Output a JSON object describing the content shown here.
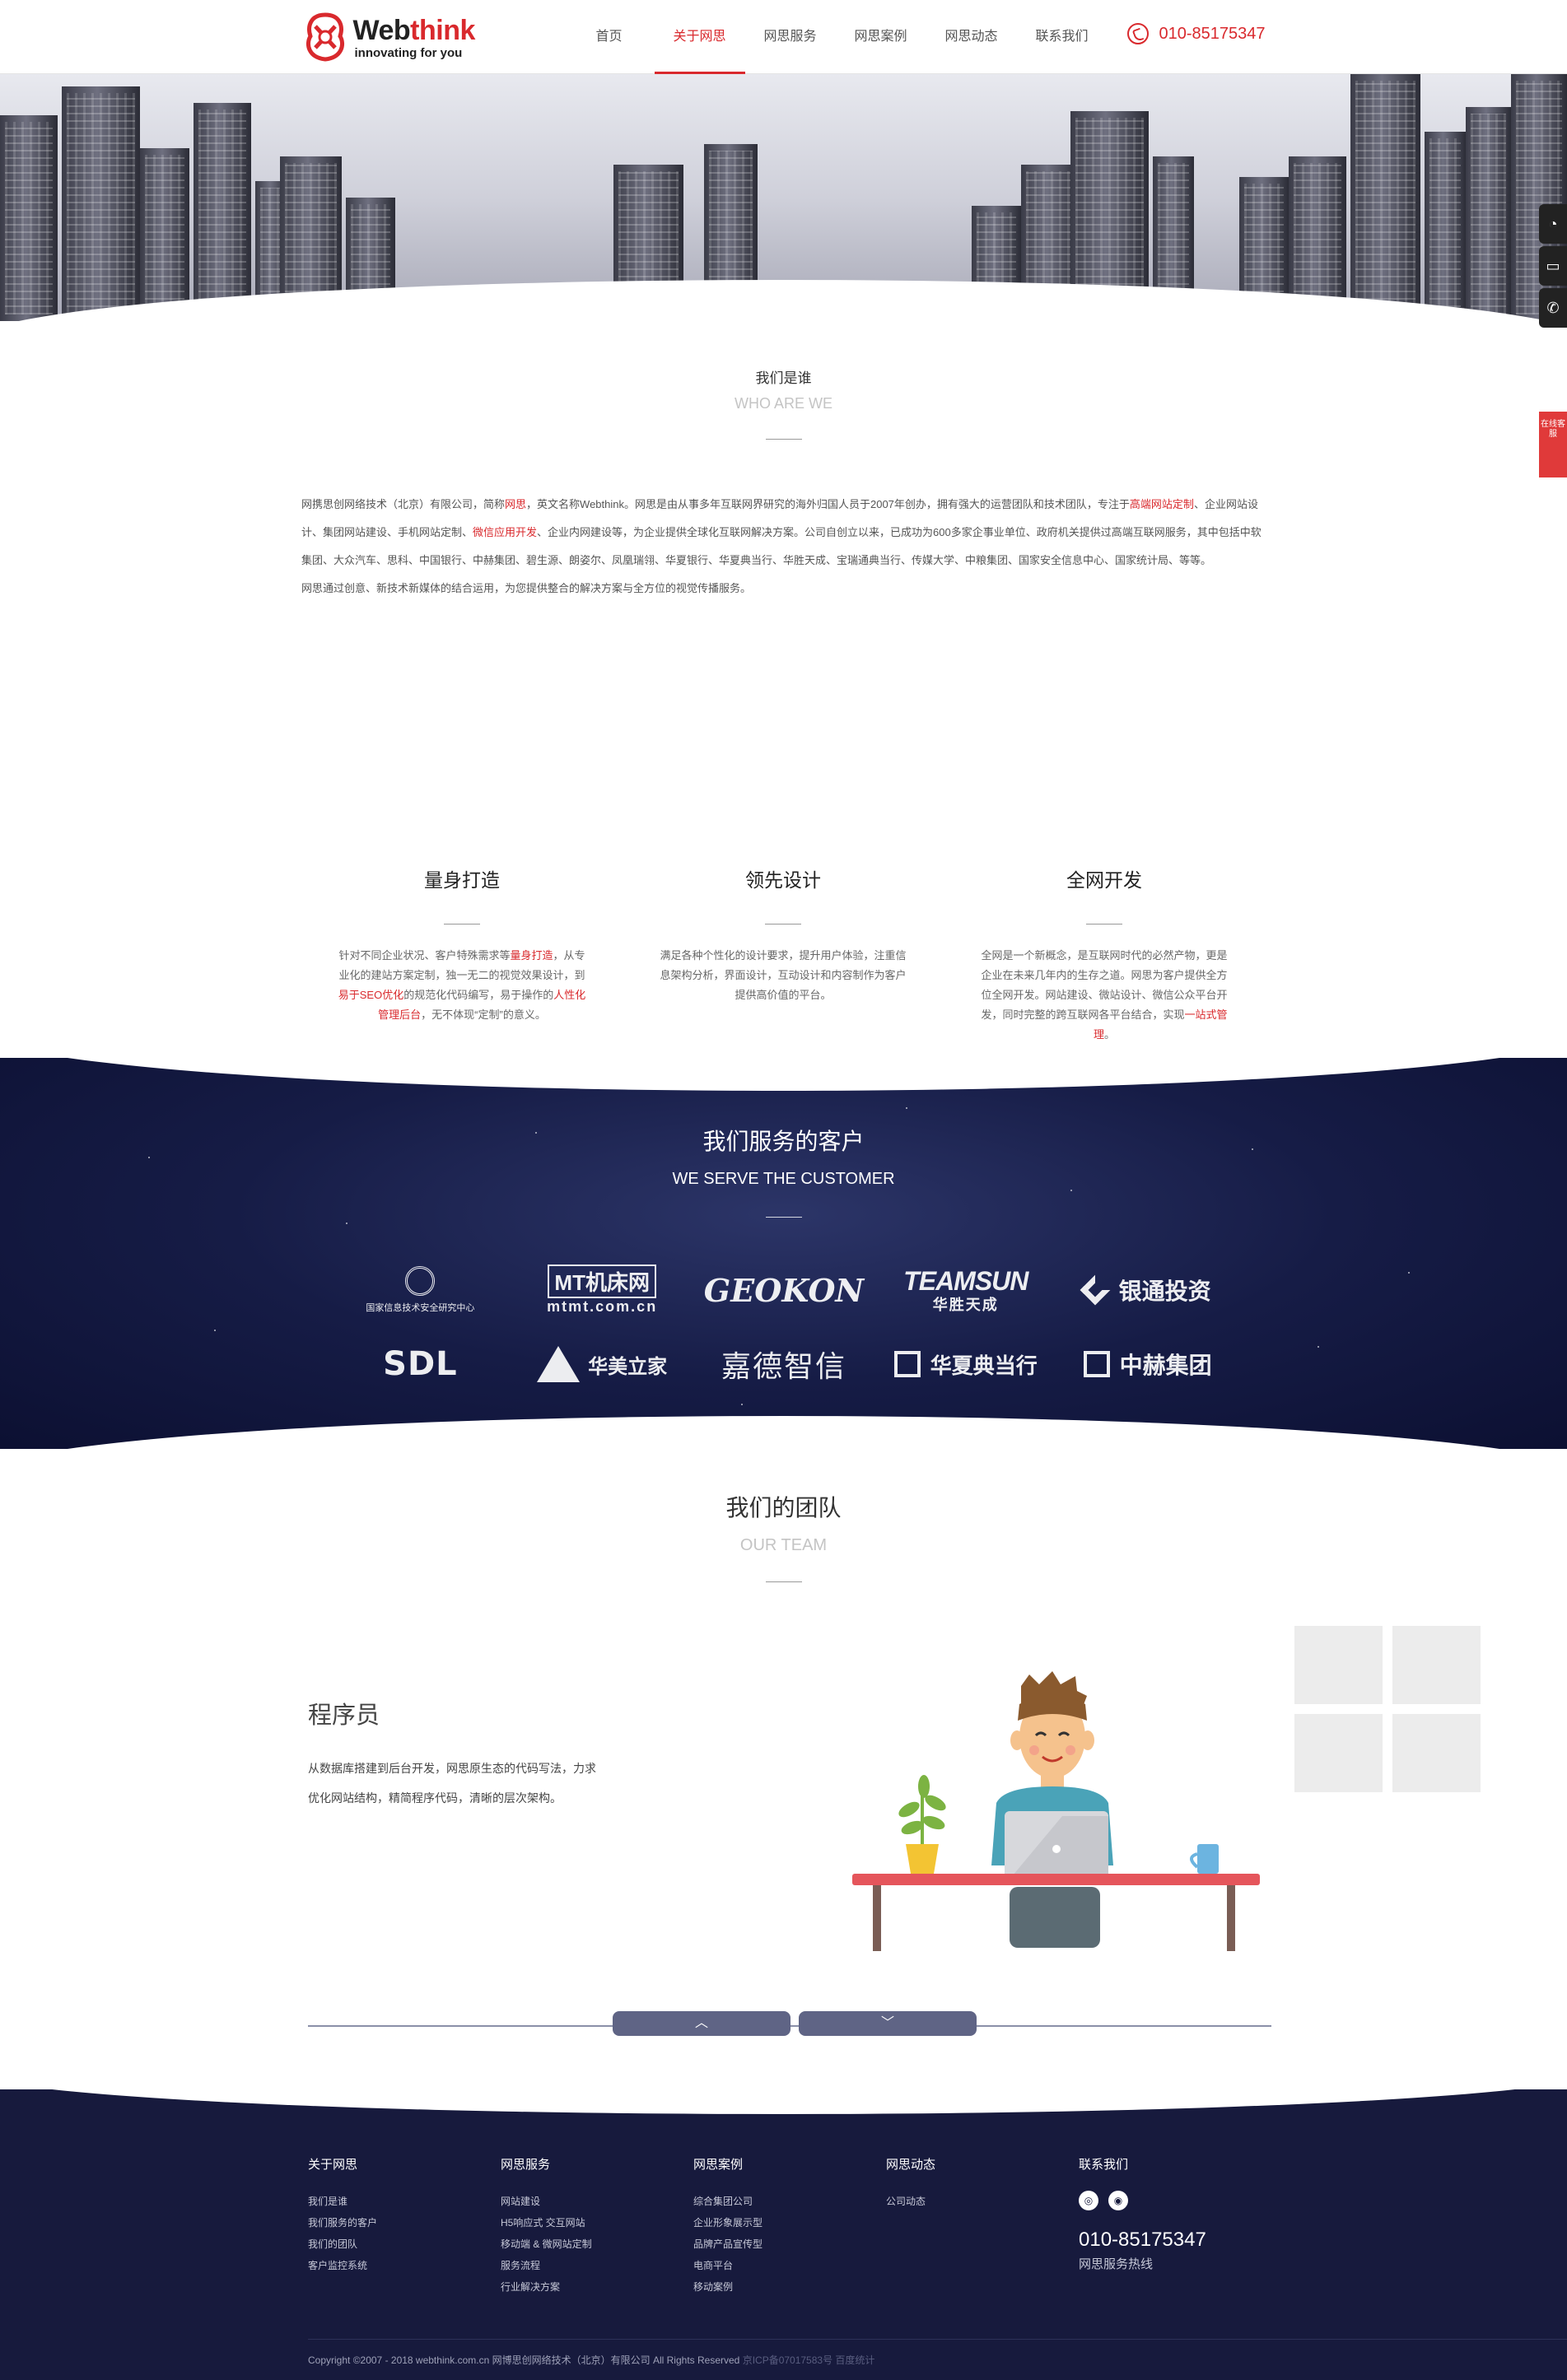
{
  "header": {
    "brand": {
      "name_a": "Web",
      "name_b": "think",
      "tagline": "innovating for you"
    },
    "nav": [
      {
        "label": "首页"
      },
      {
        "label": "关于网思"
      },
      {
        "label": "网思服务"
      },
      {
        "label": "网思案例"
      },
      {
        "label": "网思动态"
      },
      {
        "label": "联系我们"
      }
    ],
    "active_nav": "关于网思",
    "phone": "010-85175347"
  },
  "side": {
    "contact_label": "在线客服"
  },
  "who": {
    "title": "我们是谁",
    "subtitle": "WHO ARE WE",
    "p1_a": "网携思创网络技术（北京）有限公司，简称",
    "p1_b": "网思",
    "p1_c": "，英文名称Webthink。网思是由从事多年互联网界研究的海外归国人员于2007年创办，拥有强大的运营团队和技术团队，专注于",
    "p1_d": "高端网站定制",
    "p1_e": "、企业网站设计、集团网站建设、手机网站定制、",
    "p1_f": "微信应用开发",
    "p1_g": "、企业内网建设等，为企业提供全球化互联网解决方案。公司自创立以来，已成功为600多家企事业单位、政府机关提供过高端互联网服务，其中包括中软集团、大众汽车、思科、中国银行、中赫集团、碧生源、朗姿尔、凤凰瑞翎、华夏银行、华夏典当行、华胜天成、宝瑞通典当行、传媒大学、中粮集团、国家安全信息中心、国家统计局、等等。",
    "p2": "网思通过创意、新技术新媒体的结合运用，为您提供整合的解决方案与全方位的视觉传播服务。"
  },
  "features": [
    {
      "title": "量身打造",
      "a": "针对不同企业状况、客户特殊需求等",
      "b": "量身打造",
      "c": "，从专业化的建站方案定制，独一无二的视觉效果设计，到",
      "d": "易于SEO优化",
      "e": "的规范化代码编写，易于操作的",
      "f": "人性化管理后台",
      "g": "，无不体现“定制”的意义。"
    },
    {
      "title": "领先设计",
      "a": "满足各种个性化的设计要求，提升用户体验，注重信息架构分析，界面设计，互动设计和内容制作为客户提供高价值的平台。"
    },
    {
      "title": "全网开发",
      "a": "全网是一个新概念，是互联网时代的必然产物，更是企业在未来几年内的生存之道。网思为客户提供全方位全网开发。网站建设、微站设计、微信公众平台开发，同时完整的跨互联网各平台结合，实现",
      "b": "一站式管理",
      "c": "。"
    }
  ],
  "clients": {
    "title": "我们服务的客户",
    "subtitle": "WE SERVE THE CUSTOMER",
    "logos": [
      {
        "text": "国家信息技术安全研究中心"
      },
      {
        "top": "MT机床网",
        "bottom": "mtmt.com.cn"
      },
      {
        "text": "GEOKON"
      },
      {
        "top": "TEAMSUN",
        "bottom": "华胜天成"
      },
      {
        "text": "银通投资"
      },
      {
        "text": "SDL"
      },
      {
        "text": "华美立家"
      },
      {
        "text": "嘉德智信"
      },
      {
        "text": "华夏典当行"
      },
      {
        "text": "中赫集团"
      }
    ]
  },
  "team": {
    "title": "我们的团队",
    "subtitle": "OUR TEAM",
    "role": "程序员",
    "desc": "从数据库搭建到后台开发，网思原生态的代码写法，力求优化网站结构，精简程序代码，清晰的层次架构。",
    "prev": "︿",
    "next": "﹀"
  },
  "footer": {
    "cols": [
      {
        "title": "关于网思",
        "links": [
          "我们是谁",
          "我们服务的客户",
          "我们的团队",
          "客户监控系统"
        ]
      },
      {
        "title": "网思服务",
        "links": [
          "网站建设",
          "H5响应式 交互网站",
          "移动端 & 微网站定制",
          "服务流程",
          "行业解决方案"
        ]
      },
      {
        "title": "网思案例",
        "links": [
          "综合集团公司",
          "企业形象展示型",
          "品牌产品宣传型",
          "电商平台",
          "移动案例"
        ]
      },
      {
        "title": "网思动态",
        "links": [
          "公司动态"
        ]
      }
    ],
    "contact_title": "联系我们",
    "hotline": "010-85175347",
    "hotline_label": "网思服务热线",
    "copyright": "Copyright ©2007 - 2018 webthink.com.cn 网博思创网络技术（北京）有限公司 All Rights Reserved",
    "icp": "京ICP备07017583号 百度统计"
  }
}
